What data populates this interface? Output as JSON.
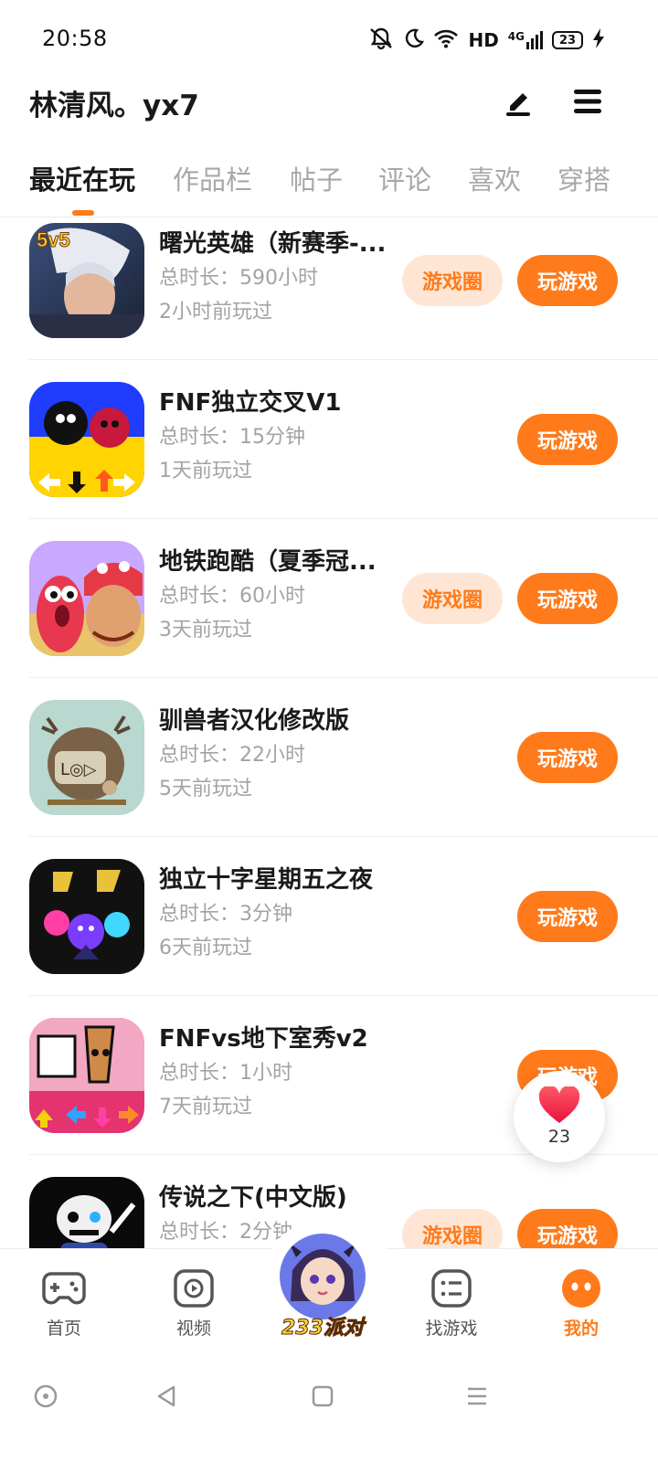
{
  "status_bar": {
    "time": "20:58",
    "network_label": "HD",
    "network_type": "4G",
    "battery": "23"
  },
  "header": {
    "username": "林清风。yx7"
  },
  "tabs": [
    {
      "label": "最近在玩",
      "active": true
    },
    {
      "label": "作品栏",
      "active": false
    },
    {
      "label": "帖子",
      "active": false
    },
    {
      "label": "评论",
      "active": false
    },
    {
      "label": "喜欢",
      "active": false
    },
    {
      "label": "穿搭",
      "active": false
    }
  ],
  "games": [
    {
      "name": "曙光英雄（新赛季-...",
      "duration": "总时长：590小时",
      "last_played": "2小时前玩过",
      "circle_label": "游戏圈",
      "play_label": "玩游戏",
      "icon": "hero-portrait-icon"
    },
    {
      "name": "FNF独立交叉V1",
      "duration": "总时长：15分钟",
      "last_played": "1天前玩过",
      "circle_label": "",
      "play_label": "玩游戏",
      "icon": "fnf-characters-icon"
    },
    {
      "name": "地铁跑酷（夏季冠...",
      "duration": "总时长：60小时",
      "last_played": "3天前玩过",
      "circle_label": "游戏圈",
      "play_label": "玩游戏",
      "icon": "subway-runner-icon"
    },
    {
      "name": "驯兽者汉化修改版",
      "duration": "总时长：22小时",
      "last_played": "5天前玩过",
      "circle_label": "",
      "play_label": "玩游戏",
      "icon": "beast-tamer-icon"
    },
    {
      "name": "独立十字星期五之夜",
      "duration": "总时长：3分钟",
      "last_played": "6天前玩过",
      "circle_label": "",
      "play_label": "玩游戏",
      "icon": "friday-night-icon"
    },
    {
      "name": "FNFvs地下室秀v2",
      "duration": "总时长：1小时",
      "last_played": "7天前玩过",
      "circle_label": "",
      "play_label": "玩游戏",
      "icon": "basement-show-icon"
    },
    {
      "name": "传说之下(中文版)",
      "duration": "总时长：2分钟",
      "last_played": "",
      "circle_label": "游戏圈",
      "play_label": "玩游戏",
      "icon": "undertale-icon"
    }
  ],
  "like_fab": {
    "count": "23",
    "icon": "heart-icon"
  },
  "bottom_nav": [
    {
      "label": "首页",
      "icon": "gamepad-icon",
      "active": false
    },
    {
      "label": "视频",
      "icon": "video-play-icon",
      "active": false
    },
    {
      "label": "233派对",
      "icon": "party-avatar-icon",
      "active": false
    },
    {
      "label": "找游戏",
      "icon": "list-icon",
      "active": false
    },
    {
      "label": "我的",
      "icon": "profile-face-icon",
      "active": true
    }
  ],
  "colors": {
    "accent": "#ff7a1a",
    "accent_light": "#ffe6d4",
    "text_primary": "#1a1a1a",
    "text_secondary": "#a3a3a3"
  }
}
